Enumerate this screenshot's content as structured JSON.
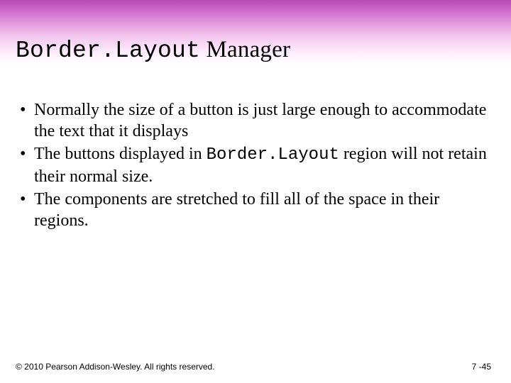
{
  "title": {
    "mono_part": "Border.Layout",
    "rest": " Manager"
  },
  "bullets": [
    {
      "pre": "Normally the size of a button is just large enough to accommodate the text that it displays",
      "mono": "",
      "post": ""
    },
    {
      "pre": "The buttons displayed in ",
      "mono": "Border.Layout",
      "post": " region will not retain their normal size."
    },
    {
      "pre": "The components are stretched to fill all of the space in their regions.",
      "mono": "",
      "post": ""
    }
  ],
  "footer": {
    "copyright": "© 2010 Pearson Addison-Wesley. All rights reserved.",
    "page": "7 -45"
  }
}
